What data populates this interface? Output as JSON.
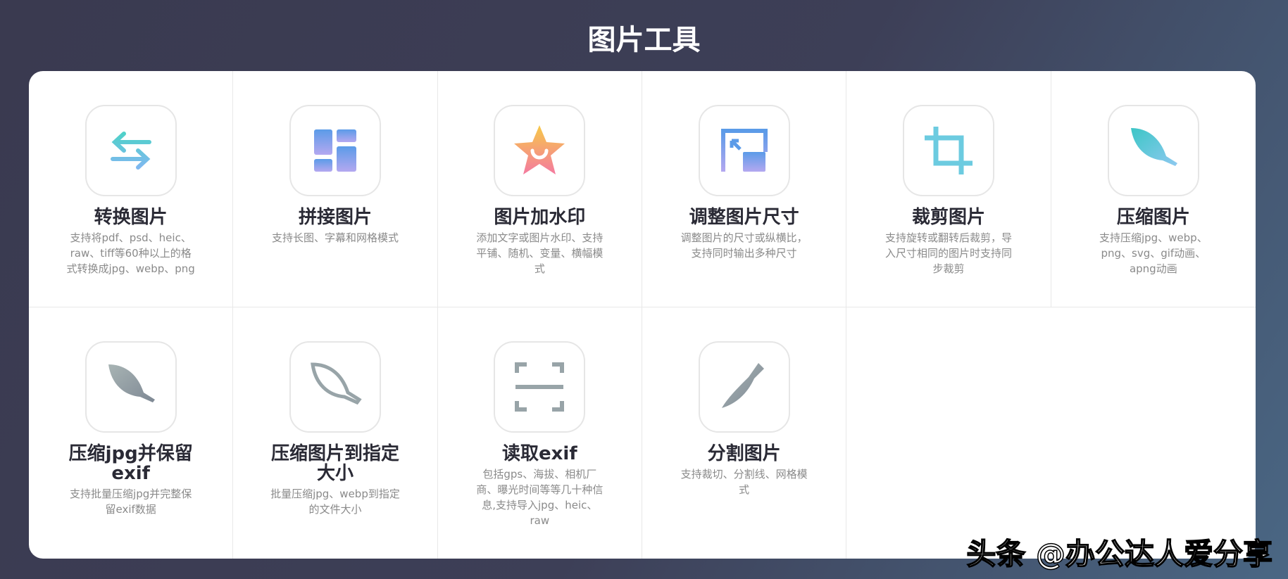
{
  "page": {
    "title": "图片工具",
    "watermark": "头条 @办公达人爱分享"
  },
  "tools": [
    {
      "name": "转换图片",
      "desc": "支持将pdf、psd、heic、raw、tiff等60种以上的格式转换成jpg、webp、png",
      "icon": "convert-arrows-icon"
    },
    {
      "name": "拼接图片",
      "desc": "支持长图、字幕和网格模式",
      "icon": "layout-grid-icon"
    },
    {
      "name": "图片加水印",
      "desc": "添加文字或图片水印、支持平铺、随机、变量、横幅模式",
      "icon": "star-icon"
    },
    {
      "name": "调整图片尺寸",
      "desc": "调整图片的尺寸或纵横比，支持同时输出多种尺寸",
      "icon": "resize-icon"
    },
    {
      "name": "裁剪图片",
      "desc": "支持旋转或翻转后裁剪，导入尺寸相同的图片时支持同步裁剪",
      "icon": "crop-icon"
    },
    {
      "name": "压缩图片",
      "desc": "支持压缩jpg、webp、png、svg、gif动画、apng动画",
      "icon": "feather-icon"
    },
    {
      "name": "压缩jpg并保留exif",
      "desc": "支持批量压缩jpg并完整保留exif数据",
      "icon": "feather-icon"
    },
    {
      "name": "压缩图片到指定大小",
      "desc": "批量压缩jpg、webp到指定的文件大小",
      "icon": "feather-outline-icon"
    },
    {
      "name": "读取exif",
      "desc": "包括gps、海拔、相机厂商、曝光时间等等几十种信息,支持导入jpg、heic、raw",
      "icon": "scan-icon"
    },
    {
      "name": "分割图片",
      "desc": "支持裁切、分割线、网格模式",
      "icon": "knife-icon"
    }
  ]
}
